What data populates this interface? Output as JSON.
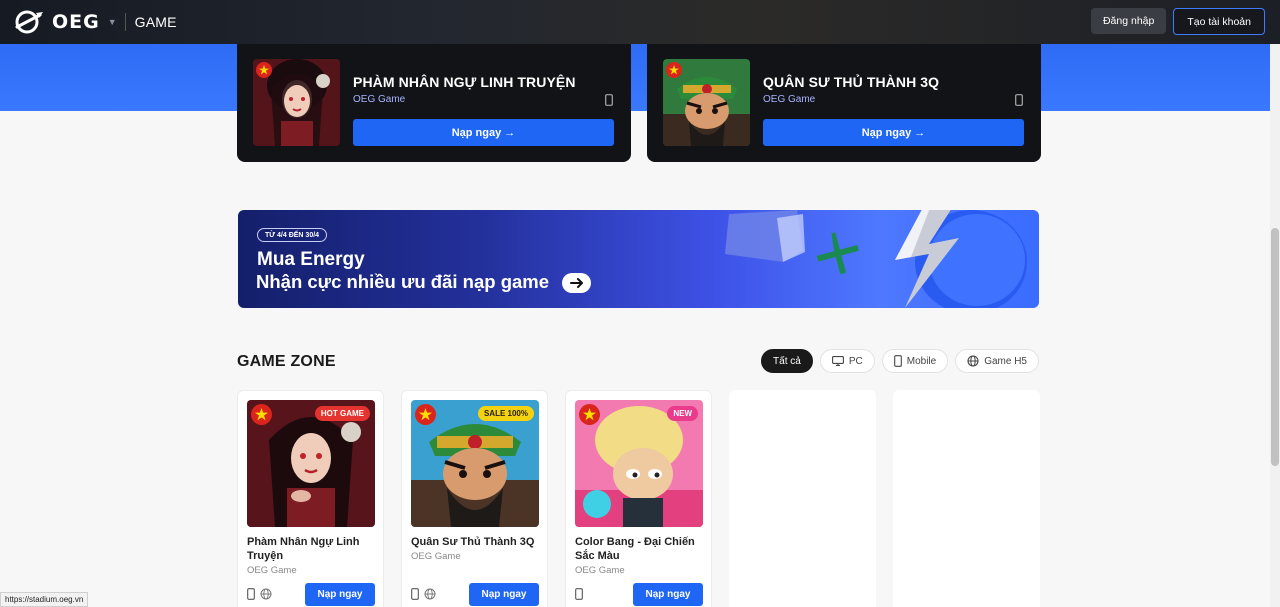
{
  "header": {
    "logo_text": "OEG",
    "section": "GAME",
    "login_label": "Đăng nhập",
    "register_label": "Tạo tài khoản"
  },
  "featured": [
    {
      "title": "PHÀM NHÂN NGỰ LINH TRUYỆN",
      "publisher": "OEG Game",
      "button": "Nạp ngay →"
    },
    {
      "title": "QUÂN SƯ THỦ THÀNH 3Q",
      "publisher": "OEG Game",
      "button": "Nạp ngay →"
    }
  ],
  "banner": {
    "pill": "TỪ 4/4 ĐẾN 30/4",
    "line1": "Mua Energy",
    "line2": "Nhận cực nhiều ưu đãi nạp game"
  },
  "zone": {
    "title": "GAME ZONE",
    "filters": [
      "Tất cả",
      "PC",
      "Mobile",
      "Game H5"
    ],
    "active_filter": "Tất cả"
  },
  "games": [
    {
      "name": "Phàm Nhân Ngự Linh Truyện",
      "publisher": "OEG Game",
      "badge": "HOT GAME",
      "badge_color": "#e5342f",
      "button": "Nạp ngay",
      "platforms": [
        "phone-icon",
        "globe-icon"
      ]
    },
    {
      "name": "Quân Sư Thủ Thành 3Q",
      "publisher": "OEG Game",
      "badge": "SALE 100%",
      "badge_color": "#f5d20f",
      "button": "Nạp ngay",
      "platforms": [
        "phone-icon",
        "globe-icon"
      ]
    },
    {
      "name": "Color Bang - Đại Chiến Sắc Màu",
      "publisher": "OEG Game",
      "badge": "NEW",
      "badge_color": "#e93a8b",
      "button": "Nạp ngay",
      "platforms": [
        "phone-icon"
      ]
    }
  ],
  "status_url": "https://stadium.oeg.vn",
  "colors": {
    "primary": "#1f66f5",
    "header_bg": "#161a22",
    "band": "#3a78ff"
  }
}
